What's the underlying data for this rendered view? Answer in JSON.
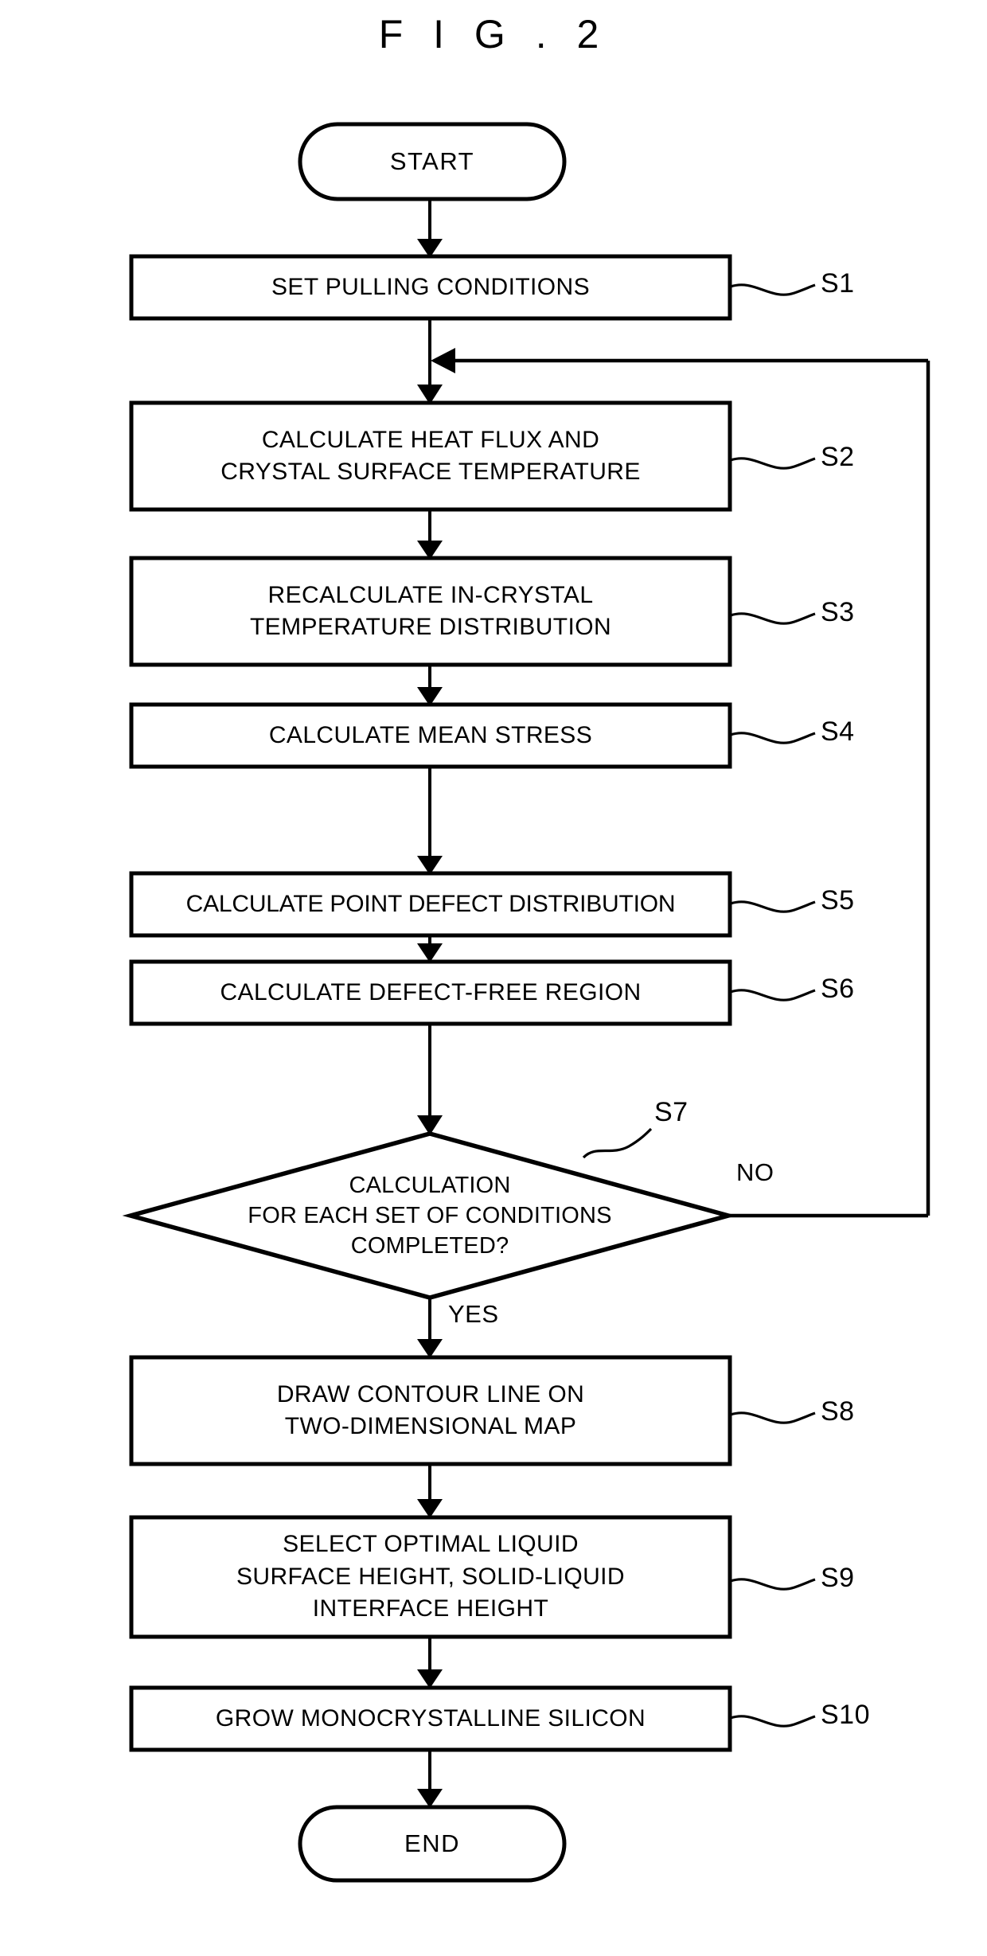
{
  "figure": {
    "title": "F I G . 2",
    "stroke_color": "#000000",
    "fill_color": "#ffffff"
  },
  "terminals": {
    "start": {
      "label": "START"
    },
    "end": {
      "label": "END"
    }
  },
  "steps": [
    {
      "ref": "S1",
      "lines": [
        "SET PULLING CONDITIONS"
      ]
    },
    {
      "ref": "S2",
      "lines": [
        "CALCULATE HEAT FLUX AND",
        "CRYSTAL SURFACE TEMPERATURE"
      ]
    },
    {
      "ref": "S3",
      "lines": [
        "RECALCULATE IN-CRYSTAL",
        "TEMPERATURE DISTRIBUTION"
      ]
    },
    {
      "ref": "S4",
      "lines": [
        "CALCULATE MEAN STRESS"
      ]
    },
    {
      "ref": "S5",
      "lines": [
        "CALCULATE POINT DEFECT DISTRIBUTION"
      ]
    },
    {
      "ref": "S6",
      "lines": [
        "CALCULATE DEFECT-FREE REGION"
      ]
    },
    {
      "ref": "S8",
      "lines": [
        "DRAW CONTOUR LINE ON",
        "TWO-DIMENSIONAL MAP"
      ]
    },
    {
      "ref": "S9",
      "lines": [
        "SELECT OPTIMAL LIQUID",
        "SURFACE HEIGHT, SOLID-LIQUID",
        "INTERFACE HEIGHT"
      ]
    },
    {
      "ref": "S10",
      "lines": [
        "GROW MONOCRYSTALLINE SILICON"
      ]
    }
  ],
  "decision": {
    "ref": "S7",
    "lines": [
      "CALCULATION",
      "FOR EACH SET OF CONDITIONS",
      "COMPLETED?"
    ],
    "branch_yes": "YES",
    "branch_no": "NO"
  }
}
